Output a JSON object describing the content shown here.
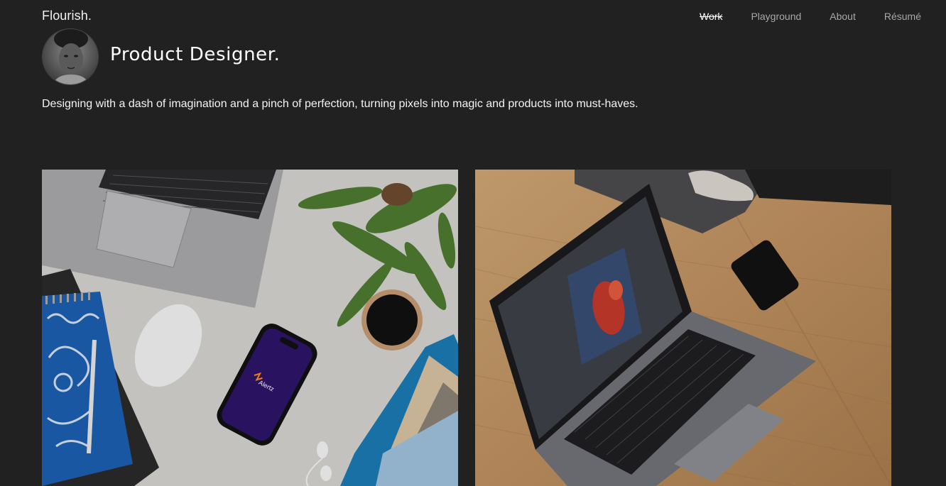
{
  "header": {
    "brand": "Flourish.",
    "nav": [
      {
        "label": "Work"
      },
      {
        "label": "Playground"
      },
      {
        "label": "About"
      },
      {
        "label": "Résumé"
      }
    ]
  },
  "hero": {
    "title": "Product Designer.",
    "tagline": "Designing with a dash of imagination and a pinch of perfection, turning pixels into magic and products into must-haves."
  },
  "projects": [
    {
      "phone_brand": "Alertz"
    },
    {}
  ],
  "colors": {
    "background": "#212121",
    "text": "#ffffff",
    "nav_muted": "#a8a8a8",
    "phone_screen": "#2d1468",
    "notebook_blue": "#1d5fb0"
  }
}
